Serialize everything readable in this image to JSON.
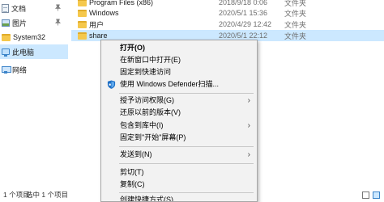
{
  "nav": {
    "items": [
      {
        "label": "文档",
        "icon": "document-icon",
        "pinned": true
      },
      {
        "label": "图片",
        "icon": "pictures-icon",
        "pinned": true
      },
      {
        "label": "System32",
        "icon": "folder-icon",
        "pinned": false
      },
      {
        "label": "此电脑",
        "icon": "computer-icon",
        "pinned": false,
        "selected": true
      },
      {
        "label": "网络",
        "icon": "network-icon",
        "pinned": false
      }
    ]
  },
  "files": [
    {
      "name": "Program Files (x86)",
      "date": "2018/9/18 0:06",
      "type": "文件夹"
    },
    {
      "name": "Windows",
      "date": "2020/5/1 15:36",
      "type": "文件夹"
    },
    {
      "name": "用户",
      "date": "2020/4/29 12:42",
      "type": "文件夹"
    },
    {
      "name": "share",
      "date": "2020/5/1 22:12",
      "type": "文件夹",
      "selected": true
    }
  ],
  "status": {
    "item_count": "1 个项目",
    "selected_count": "选中 1 个项目"
  },
  "context_menu": {
    "open": "打开(O)",
    "open_new_window": "在新窗口中打开(E)",
    "pin_quick_access": "固定到快速访问",
    "defender_scan": "使用 Windows Defender扫描...",
    "give_access": "授予访问权限(G)",
    "restore_versions": "还原以前的版本(V)",
    "include_library": "包含到库中(I)",
    "pin_start": "固定到\"开始\"屏幕(P)",
    "send_to": "发送到(N)",
    "cut": "剪切(T)",
    "copy": "复制(C)",
    "create_shortcut": "创建快捷方式(S)"
  },
  "colors": {
    "selection": "#cce8ff",
    "menu_background": "#f2f2f2",
    "folder": "#f5c84c"
  }
}
